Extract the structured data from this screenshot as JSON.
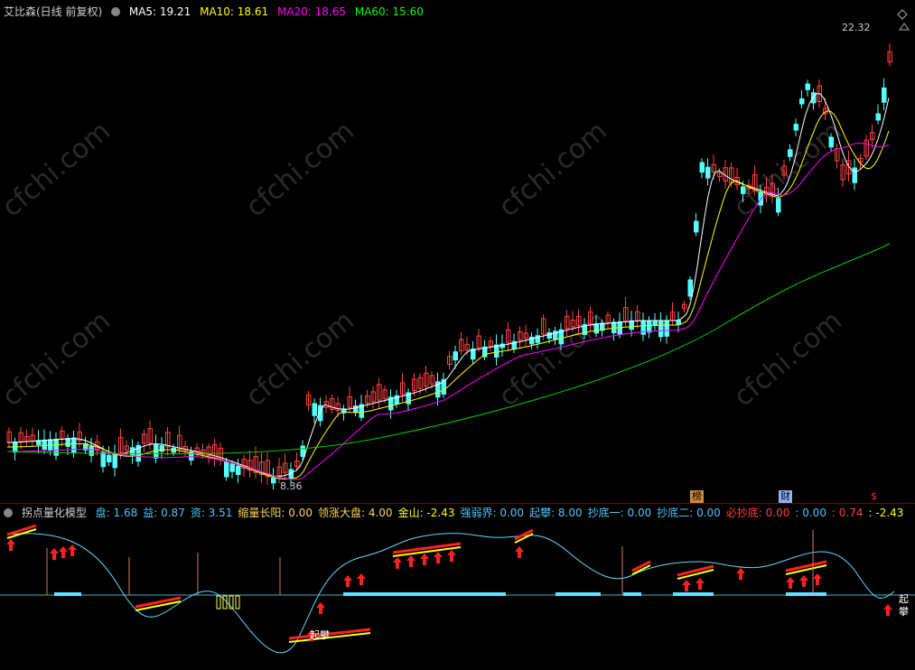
{
  "main": {
    "title": "艾比森(日线 前复权)",
    "ma": [
      {
        "label": "MA5: 19.21",
        "color": "#ffffff"
      },
      {
        "label": "MA10: 18.61",
        "color": "#ffff00"
      },
      {
        "label": "MA20: 18.65",
        "color": "#ff00ff"
      },
      {
        "label": "MA60: 15.60",
        "color": "#00ff00"
      }
    ],
    "high_label": "22.32",
    "low_label": "8.36",
    "tags": [
      {
        "text": "榜",
        "color": "#000000",
        "bg": "#d08a3a"
      },
      {
        "text": "财",
        "color": "#000000",
        "bg": "#8fb0ff"
      },
      {
        "text": "$",
        "color": "#ff3030",
        "bg": "transparent"
      }
    ]
  },
  "sub": {
    "title": "拐点量化模型",
    "items": [
      {
        "label": "盘: 1.68",
        "color": "#4fc3f7"
      },
      {
        "label": "益: 0.87",
        "color": "#4fc3f7"
      },
      {
        "label": "资: 3.51",
        "color": "#4fc3f7"
      },
      {
        "label": "缩量长阳: 0.00",
        "color": "#ffd54f"
      },
      {
        "label": "领涨大盘: 4.00",
        "color": "#ffd54f"
      },
      {
        "label": "金山: -2.43",
        "color": "#ffff00"
      },
      {
        "label": "强弱界: 0.00",
        "color": "#4fc3f7"
      },
      {
        "label": "起攀: 8.00",
        "color": "#4fc3f7"
      },
      {
        "label": "抄底一: 0.00",
        "color": "#4fc3f7"
      },
      {
        "label": "抄底二: 0.00",
        "color": "#4fc3f7"
      },
      {
        "label": "必抄底: 0.00",
        "color": "#ff4040"
      },
      {
        "label": ": 0.00",
        "color": "#4fc3f7"
      },
      {
        "label": ": 0.74",
        "color": "#ff4040"
      },
      {
        "label": ": -2.43",
        "color": "#ffff00"
      }
    ],
    "annotations": [
      "起攀",
      "起攀"
    ]
  },
  "watermark": "cfchi.com"
}
